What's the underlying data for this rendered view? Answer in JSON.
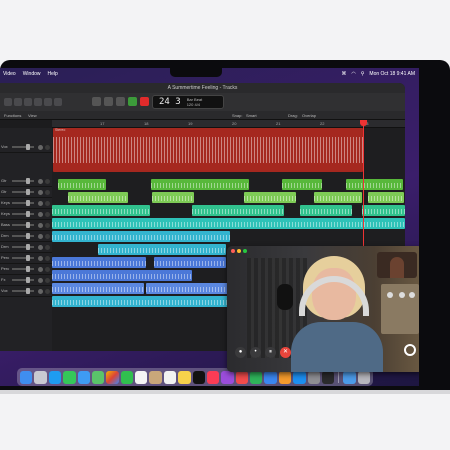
{
  "menubar": {
    "items": [
      "Video",
      "Window",
      "Help"
    ],
    "clock": "Mon Oct 18  9:41 AM"
  },
  "logic": {
    "title": "A Summertime Feeling - Tracks",
    "lcd_big": "24 3",
    "lcd_small_1": "Bar  Beat",
    "lcd_small_2": "120 4/4",
    "toolrow": {
      "functions": "Functions",
      "view": "View",
      "snap_label": "Snap:",
      "snap_value": "Smart",
      "drag_label": "Drag:",
      "drag_value": "Overlap"
    },
    "ruler": [
      "17",
      "18",
      "19",
      "20",
      "21",
      "22",
      "23",
      "24"
    ],
    "region_top_label": "Stereo"
  },
  "tracks": [
    "Vox",
    "Gtr",
    "Gtr",
    "Keys",
    "Keys",
    "Bass",
    "Drm",
    "Drm",
    "Perc",
    "Perc",
    "Fx",
    "Vox"
  ],
  "facetime": {
    "controls": [
      "●",
      "•",
      "⏸",
      "✕"
    ]
  },
  "colors": {
    "red_region": "#a5281f",
    "green_region": "#58b83a",
    "green_light": "#7ecb56",
    "teal_region": "#2ec2b8",
    "blue_region": "#4b78d8",
    "cyan_region": "#33b4cf"
  },
  "dock_icons": [
    "finder-icon",
    "launchpad-icon",
    "safari-icon",
    "messages-icon",
    "mail-icon",
    "maps-icon",
    "photos-icon",
    "facetime-icon",
    "calendar-icon",
    "contacts-icon",
    "reminders-icon",
    "notes-icon",
    "tv-icon",
    "music-icon",
    "podcasts-icon",
    "news-icon",
    "numbers-icon",
    "keynote-icon",
    "pages-icon",
    "appstore-icon",
    "settings-icon",
    "logic-icon",
    "downloads-icon",
    "trash-icon"
  ]
}
